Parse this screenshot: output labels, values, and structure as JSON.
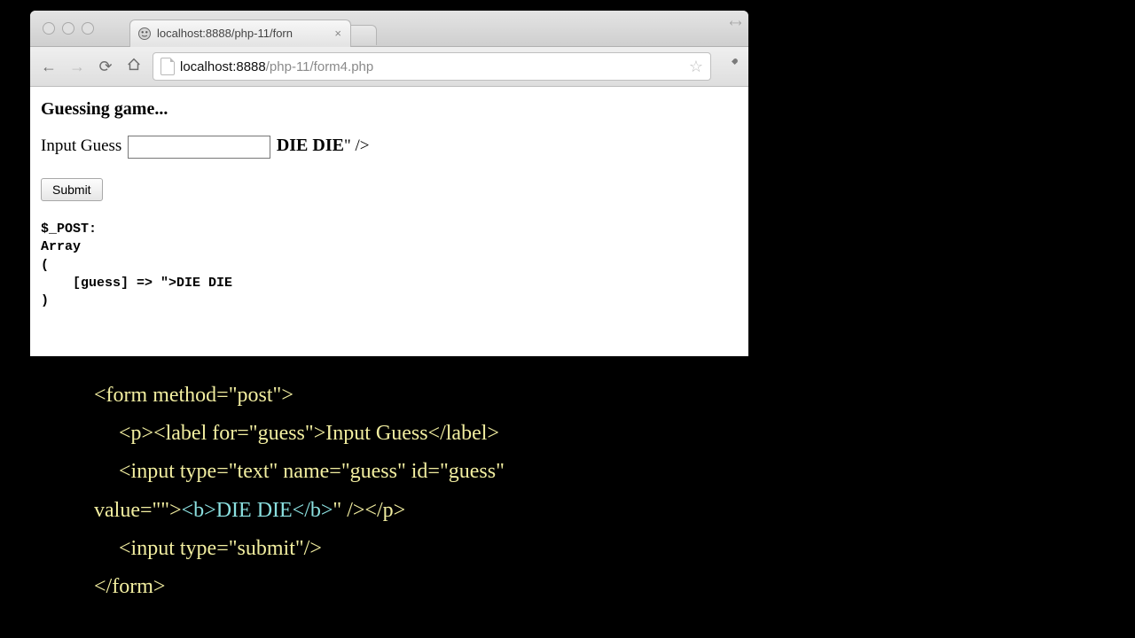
{
  "browser": {
    "tab_title": "localhost:8888/php-11/forn",
    "url_host": "localhost",
    "url_port": ":8888",
    "url_path": "/php-11/form4.php"
  },
  "page": {
    "heading": "Guessing game...",
    "label": "Input Guess",
    "leaked_bold": "DIE DIE",
    "leaked_tail": "\" />",
    "submit": "Submit",
    "dump": "$_POST:\nArray\n(\n    [guess] => \">DIE DIE\n)"
  },
  "code": {
    "l1": "<form method=\"post\">",
    "l2": "<p><label for=\"guess\">Input Guess</label>",
    "l3": "<input type=\"text\" name=\"guess\" id=\"guess\"",
    "l4_a": "value=\"\">",
    "l4_b": "<b>DIE DIE</b>",
    "l4_c": "\"   /></p>",
    "l5": "<input type=\"submit\"/>",
    "l6": "</form>"
  }
}
